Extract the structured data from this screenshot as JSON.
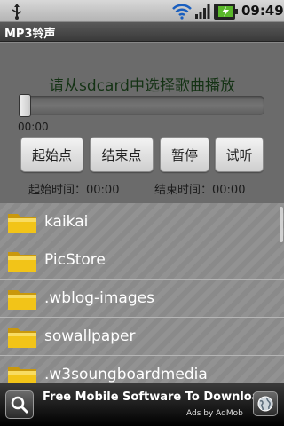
{
  "status_bar": {
    "time": "09:49",
    "icons": [
      "usb-icon",
      "wifi-icon",
      "signal-icon",
      "battery-charging-icon"
    ]
  },
  "app": {
    "title": "MP3铃声"
  },
  "player": {
    "prompt": "请从sdcard中选择歌曲播放",
    "current_time": "00:00",
    "progress": 0,
    "buttons": {
      "start_point": "起始点",
      "end_point": "结束点",
      "pause": "暂停",
      "preview": "试听"
    },
    "start_time_label": "起始时间：00:00",
    "end_time_label": "结束时间：00:00"
  },
  "files": [
    {
      "name": "kaikai",
      "icon": "folder-icon"
    },
    {
      "name": "PicStore",
      "icon": "folder-icon"
    },
    {
      "name": ".wblog-images",
      "icon": "folder-icon"
    },
    {
      "name": "sowallpaper",
      "icon": "folder-icon"
    },
    {
      "name": ".w3soungboardmedia",
      "icon": "folder-icon"
    }
  ],
  "ad": {
    "headline": "Free Mobile Software To Download",
    "attribution": "Ads by AdMob"
  },
  "colors": {
    "prompt_text": "#143214",
    "panel_bg": "#6b6b6b",
    "folder_yellow": "#f2c418"
  }
}
